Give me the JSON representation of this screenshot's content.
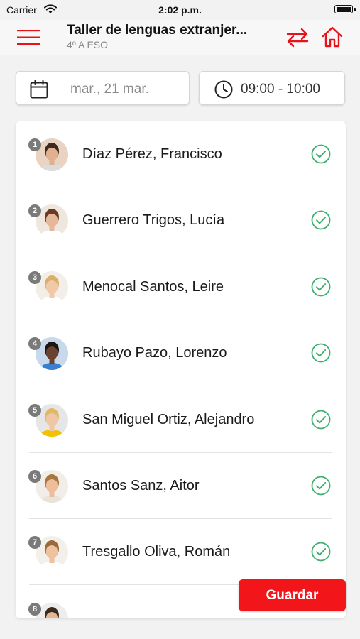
{
  "status_bar": {
    "carrier": "Carrier",
    "time": "2:02 p.m.",
    "battery_level": 1.0
  },
  "header": {
    "title": "Taller de lenguas extranjer...",
    "subtitle": "4º A ESO",
    "accent_color": "#e8131a"
  },
  "date_picker": {
    "value": "mar., 21 mar.",
    "icon": "calendar-icon"
  },
  "time_picker": {
    "value": "09:00 - 10:00",
    "icon": "clock-icon"
  },
  "students": [
    {
      "number": "1",
      "name": "Díaz Pérez, Francisco",
      "status": "present",
      "avatar_bg": "#e9d3c2",
      "skin": "#e0b08f",
      "hair": "#3b2a1d",
      "shirt": "#dcdcdc"
    },
    {
      "number": "2",
      "name": "Guerrero Trigos, Lucía",
      "status": "present",
      "avatar_bg": "#efe6de",
      "skin": "#e7b79a",
      "hair": "#6b3a22",
      "shirt": "#ffffff"
    },
    {
      "number": "3",
      "name": "Menocal Santos, Leire",
      "status": "present",
      "avatar_bg": "#f3efe8",
      "skin": "#f0c9a8",
      "hair": "#d8b06a",
      "shirt": "#ffffff"
    },
    {
      "number": "4",
      "name": "Rubayo Pazo, Lorenzo",
      "status": "present",
      "avatar_bg": "#c7d9ea",
      "skin": "#6a4330",
      "hair": "#1c1410",
      "shirt": "#3a7fcf"
    },
    {
      "number": "5",
      "name": "San Miguel Ortiz, Alejandro",
      "status": "present",
      "avatar_bg": "#e6e6e6",
      "skin": "#f0c7a5",
      "hair": "#e0b867",
      "shirt": "#f2c200"
    },
    {
      "number": "6",
      "name": "Santos Sanz, Aitor",
      "status": "present",
      "avatar_bg": "#f1eee9",
      "skin": "#eebd9c",
      "hair": "#a8773f",
      "shirt": "#e9e4da"
    },
    {
      "number": "7",
      "name": "Tresgallo Oliva, Román",
      "status": "present",
      "avatar_bg": "#f3f0ec",
      "skin": "#efc19e",
      "hair": "#9a6a3a",
      "shirt": "#ffffff"
    },
    {
      "number": "8",
      "name": "",
      "status": "present",
      "avatar_bg": "#ededed",
      "skin": "#e6b593",
      "hair": "#3b2a1d",
      "shirt": "#dddddd"
    }
  ],
  "check_color": "#3fae6e",
  "save_button": {
    "label": "Guardar",
    "color": "#f2151a"
  }
}
